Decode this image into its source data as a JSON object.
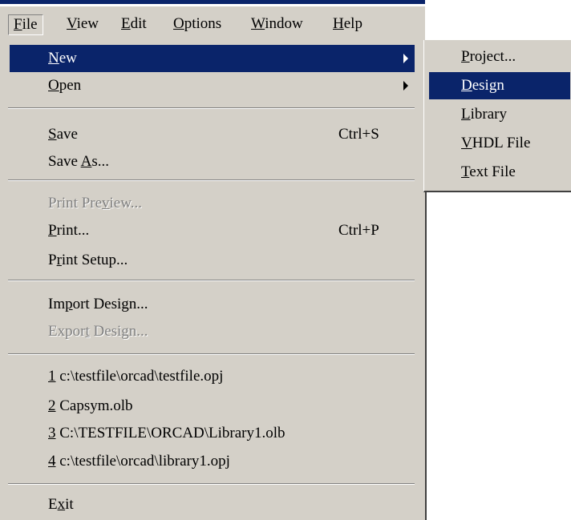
{
  "colors": {
    "menu_bg": "#d4d0c8",
    "highlight_bg": "#0a246a",
    "highlight_text": "#ffffff",
    "disabled_text": "#808080"
  },
  "menubar": {
    "items": [
      {
        "mnemonic": "F",
        "rest": "ile"
      },
      {
        "mnemonic": "V",
        "rest": "iew"
      },
      {
        "mnemonic": "E",
        "rest": "dit"
      },
      {
        "mnemonic": "O",
        "rest": "ptions"
      },
      {
        "mnemonic": "W",
        "rest": "indow"
      },
      {
        "mnemonic": "H",
        "rest": "elp"
      }
    ]
  },
  "file_menu": {
    "new": {
      "pre": "",
      "mnemonic": "N",
      "post": "ew"
    },
    "open": {
      "pre": "",
      "mnemonic": "O",
      "post": "pen"
    },
    "save": {
      "pre": "",
      "mnemonic": "S",
      "post": "ave",
      "shortcut": "Ctrl+S"
    },
    "save_as": {
      "pre": "Save ",
      "mnemonic": "A",
      "post": "s..."
    },
    "print_preview": {
      "pre": "Print Pre",
      "mnemonic": "v",
      "post": "iew..."
    },
    "print": {
      "pre": "",
      "mnemonic": "P",
      "post": "rint...",
      "shortcut": "Ctrl+P"
    },
    "print_setup": {
      "pre": "P",
      "mnemonic": "r",
      "post": "int Setup..."
    },
    "import_design": {
      "pre": "Im",
      "mnemonic": "p",
      "post": "ort Design..."
    },
    "export_design": {
      "pre": "Expor",
      "mnemonic": "t",
      "post": " Design..."
    },
    "recent": [
      {
        "mnemonic": "1",
        "post": " c:\\testfile\\orcad\\testfile.opj"
      },
      {
        "mnemonic": "2",
        "post": " Capsym.olb"
      },
      {
        "mnemonic": "3",
        "post": " C:\\TESTFILE\\ORCAD\\Library1.olb"
      },
      {
        "mnemonic": "4",
        "post": " c:\\testfile\\orcad\\library1.opj"
      }
    ],
    "exit": {
      "pre": "E",
      "mnemonic": "x",
      "post": "it"
    }
  },
  "new_submenu": {
    "project": {
      "pre": "",
      "mnemonic": "P",
      "post": "roject..."
    },
    "design": {
      "pre": "",
      "mnemonic": "D",
      "post": "esign"
    },
    "library": {
      "pre": "",
      "mnemonic": "L",
      "post": "ibrary"
    },
    "vhdl_file": {
      "pre": "",
      "mnemonic": "V",
      "post": "HDL File"
    },
    "text_file": {
      "pre": "",
      "mnemonic": "T",
      "post": "ext File"
    }
  }
}
